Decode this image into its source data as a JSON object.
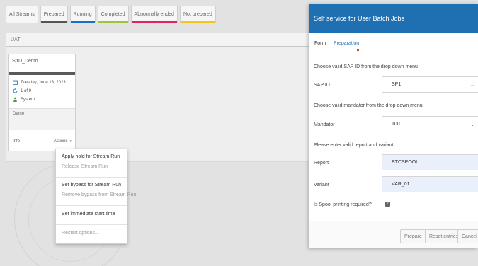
{
  "filters": [
    {
      "label": "All Streams",
      "color": ""
    },
    {
      "label": "Prepared",
      "color": "#555555"
    },
    {
      "label": "Running",
      "color": "#1a6fc4"
    },
    {
      "label": "Completed",
      "color": "#9bc53d"
    },
    {
      "label": "Abnormally ended",
      "color": "#e0245e"
    },
    {
      "label": "Not prepared",
      "color": "#f5c518"
    }
  ],
  "group": {
    "title": "UAT"
  },
  "card": {
    "title": "StrD_Demo",
    "date": "Tuesday, June 13, 2023",
    "progress": "1 of 9",
    "user": "System",
    "description": "Demo",
    "info_label": "Info",
    "actions_label": "Actions"
  },
  "actions_menu": {
    "apply_hold": "Apply hold for Stream Run",
    "release": "Release Stream Run",
    "set_bypass": "Set bypass for Stream Run",
    "remove_bypass": "Remove bypass from Stream Run",
    "set_immediate": "Set immediate start time",
    "restart": "Restart options..."
  },
  "panel": {
    "title": "Self service for User Batch Jobs",
    "tabs": {
      "form": "Form",
      "preparation": "Preparation"
    },
    "instruction_sap": "Choose valid SAP ID from the drop down menu",
    "sap_label": "SAP ID",
    "sap_value": "SP1",
    "instruction_mandator": "Choose valid mandator from the drop down menu",
    "mandator_label": "Mandator",
    "mandator_value": "100",
    "instruction_report": "Please enter valid report and variant",
    "report_label": "Report",
    "report_value": "BTCSPOOL",
    "variant_label": "Variant",
    "variant_value": "VAR_01",
    "spool_label": "Is Spool printing required?",
    "spool_checked": true,
    "buttons": {
      "prepare": "Prepare",
      "reset": "Reset entries",
      "cancel": "Cancel"
    }
  },
  "colors": {
    "header_blue": "#1f6fb3",
    "link_blue": "#2a74b6"
  }
}
